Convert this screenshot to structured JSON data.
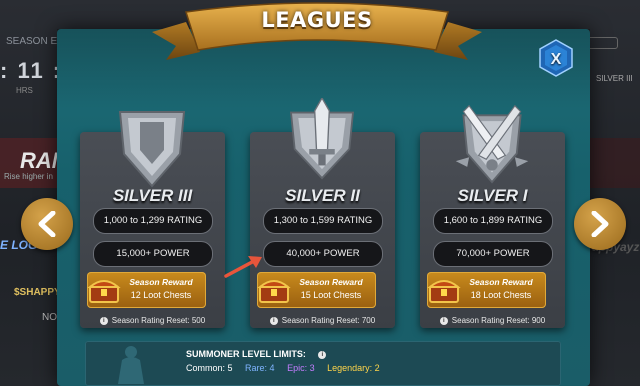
{
  "background": {
    "season_label": "SEASON E",
    "timer": ": 11 :",
    "hrs_label": "HRS",
    "rank_label": "RAN",
    "rank_sub": "Rise higher in",
    "elog": "E LOG",
    "shappy": "$SHAPPY",
    "no_label": "NO",
    "right_name": "appyayz",
    "right_silver": "SILVER III"
  },
  "modal": {
    "title": "LEAGUES",
    "close_label": "X"
  },
  "nav": {
    "prev_icon": "chevron-left-icon",
    "next_icon": "chevron-right-icon"
  },
  "leagues": [
    {
      "name": "SILVER III",
      "rating": "1,000 to 1,299 RATING",
      "power": "15,000+ POWER",
      "reward_title": "Season Reward",
      "reward_chests": "12 Loot Chests",
      "reset": "Season Rating Reset: 500"
    },
    {
      "name": "SILVER II",
      "rating": "1,300 to 1,599 RATING",
      "power": "40,000+ POWER",
      "reward_title": "Season Reward",
      "reward_chests": "15 Loot Chests",
      "reset": "Season Rating Reset: 700"
    },
    {
      "name": "SILVER I",
      "rating": "1,600 to 1,899 RATING",
      "power": "70,000+ POWER",
      "reward_title": "Season Reward",
      "reward_chests": "18 Loot Chests",
      "reset": "Season Rating Reset: 900"
    }
  ],
  "summoner": {
    "title": "SUMMONER LEVEL LIMITS:",
    "common": "Common: 5",
    "rare": "Rare: 4",
    "epic": "Epic: 3",
    "legendary": "Legendary: 2"
  },
  "colors": {
    "modal_bg": "#1e6d78",
    "gold": "#c98b1d",
    "card_bg": "#4a4e55",
    "rare": "#7fb4ff",
    "epic": "#c47dff",
    "legendary": "#ffd54a",
    "annotation_arrow": "#e8553b"
  }
}
